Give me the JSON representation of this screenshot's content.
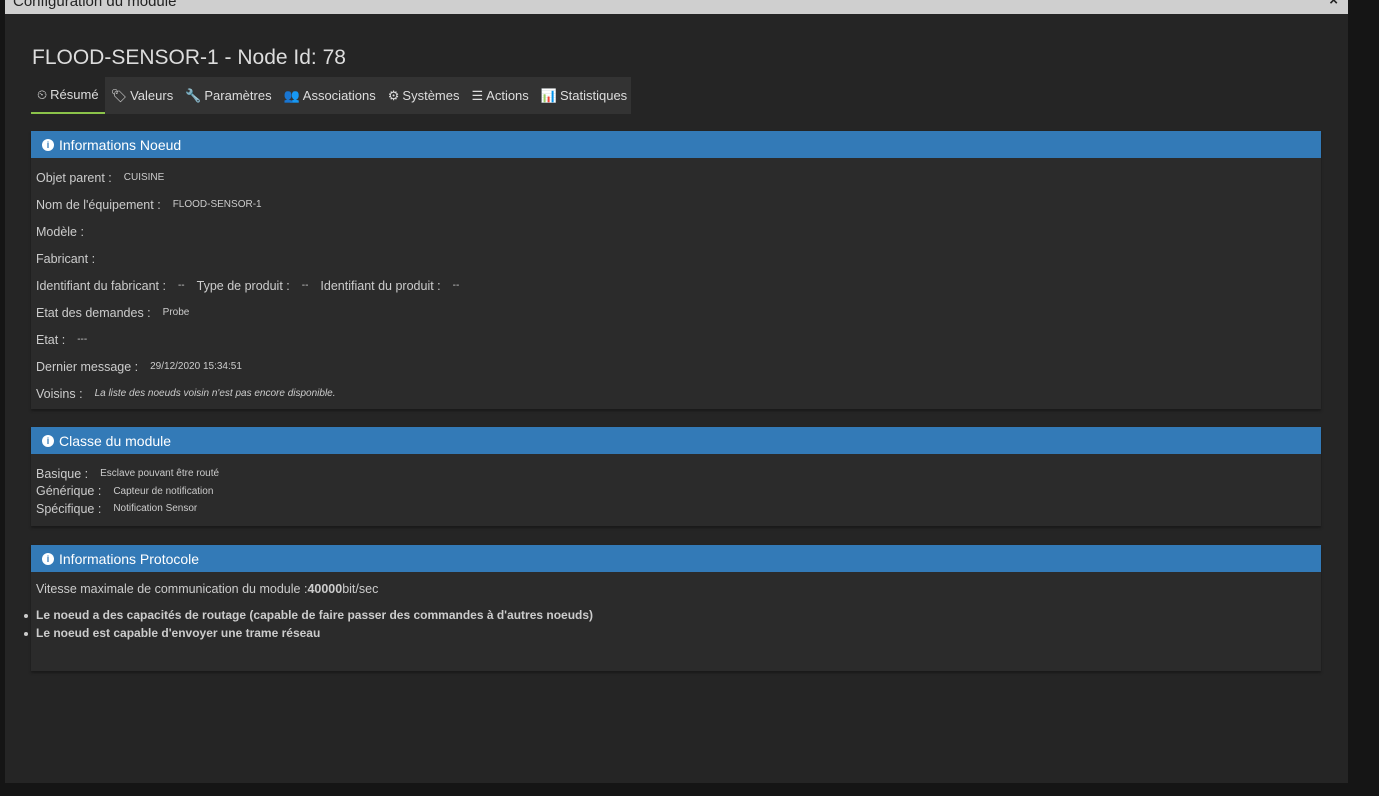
{
  "dialog": {
    "title": "Configuration du module",
    "close": "×"
  },
  "heading": "FLOOD-SENSOR-1 - Node Id: 78",
  "tabs": [
    {
      "label": "Résumé",
      "icon": "⏲"
    },
    {
      "label": "Valeurs",
      "icon": "🏷"
    },
    {
      "label": "Paramètres",
      "icon": "🔧"
    },
    {
      "label": "Associations",
      "icon": "👥"
    },
    {
      "label": "Systèmes",
      "icon": "⚙"
    },
    {
      "label": "Actions",
      "icon": "☰"
    },
    {
      "label": "Statistiques",
      "icon": "📊"
    }
  ],
  "node_info": {
    "title": "Informations Noeud",
    "objet_parent": {
      "label": "Objet parent :",
      "value": "CUISINE"
    },
    "nom": {
      "label": "Nom de l'équipement :",
      "value": "FLOOD-SENSOR-1"
    },
    "modele": {
      "label": "Modèle :"
    },
    "fabricant": {
      "label": "Fabricant :"
    },
    "id_fabricant": {
      "label": "Identifiant du fabricant :",
      "value": "--"
    },
    "type_produit": {
      "label": "Type de produit :",
      "value": "--"
    },
    "id_produit": {
      "label": "Identifiant du produit :",
      "value": "--"
    },
    "etat_demandes": {
      "label": "Etat des demandes :",
      "value": "Probe"
    },
    "etat": {
      "label": "Etat :",
      "value": "---"
    },
    "dernier_message": {
      "label": "Dernier message :",
      "value": "29/12/2020 15:34:51"
    },
    "voisins": {
      "label": "Voisins :",
      "value": "La liste des noeuds voisin n'est pas encore disponible."
    }
  },
  "classe": {
    "title": "Classe du module",
    "basique": {
      "label": "Basique :",
      "value": "Esclave pouvant être routé"
    },
    "generique": {
      "label": "Générique :",
      "value": "Capteur de notification"
    },
    "specifique": {
      "label": "Spécifique :",
      "value": "Notification Sensor"
    }
  },
  "protocole": {
    "title": "Informations Protocole",
    "vitesse_label": "Vitesse maximale de communication du module :",
    "vitesse_value": "40000",
    "vitesse_unit": " bit/sec",
    "capabilities": [
      "Le noeud a des capacités de routage (capable de faire passer des commandes à d'autres noeuds)",
      "Le noeud est capable d'envoyer une trame réseau"
    ]
  }
}
